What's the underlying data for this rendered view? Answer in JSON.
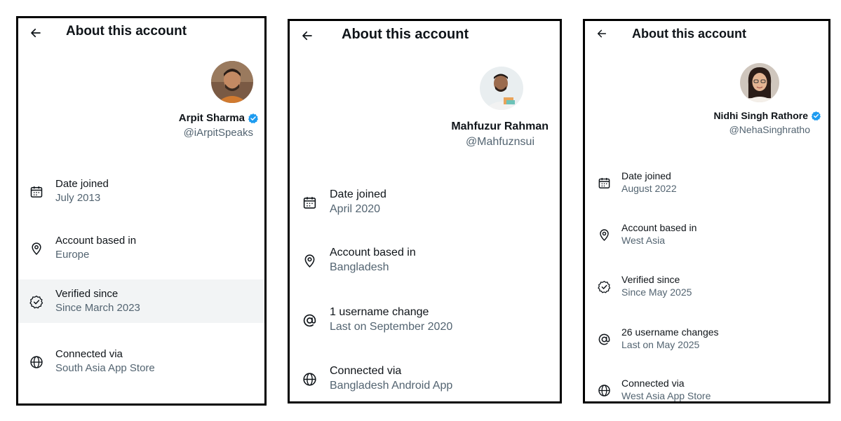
{
  "colors": {
    "verified": "#1d9bf0",
    "secondary_text": "#536471",
    "primary_text": "#0f1419",
    "highlight": "#f2f4f5"
  },
  "panels": [
    {
      "title": "About this account",
      "name": "Arpit Sharma",
      "handle": "@iArpitSpeaks",
      "items": [
        {
          "icon": "calendar-icon",
          "label": "Date joined",
          "value": "July 2013"
        },
        {
          "icon": "location-pin-icon",
          "label": "Account based in",
          "value": "Europe"
        },
        {
          "icon": "verified-check-icon",
          "label": "Verified since",
          "value": "Since March 2023"
        },
        {
          "icon": "globe-icon",
          "label": "Connected via",
          "value": "South Asia App Store"
        }
      ]
    },
    {
      "title": "About this account",
      "name": "Mahfuzur Rahman",
      "handle": "@Mahfuznsui",
      "items": [
        {
          "icon": "calendar-icon",
          "label": "Date joined",
          "value": "April 2020"
        },
        {
          "icon": "location-pin-icon",
          "label": "Account based in",
          "value": "Bangladesh"
        },
        {
          "icon": "at-sign-icon",
          "label": "1 username change",
          "value": "Last on September 2020"
        },
        {
          "icon": "globe-icon",
          "label": "Connected via",
          "value": "Bangladesh Android App"
        }
      ]
    },
    {
      "title": "About this account",
      "name": "Nidhi Singh Rathore",
      "handle": "@NehaSinghratho",
      "items": [
        {
          "icon": "calendar-icon",
          "label": "Date joined",
          "value": "August 2022"
        },
        {
          "icon": "location-pin-icon",
          "label": "Account based in",
          "value": "West Asia"
        },
        {
          "icon": "verified-check-icon",
          "label": "Verified since",
          "value": "Since May 2025"
        },
        {
          "icon": "at-sign-icon",
          "label": "26 username changes",
          "value": "Last on May 2025"
        },
        {
          "icon": "globe-icon",
          "label": "Connected via",
          "value": "West Asia App Store"
        }
      ]
    }
  ]
}
